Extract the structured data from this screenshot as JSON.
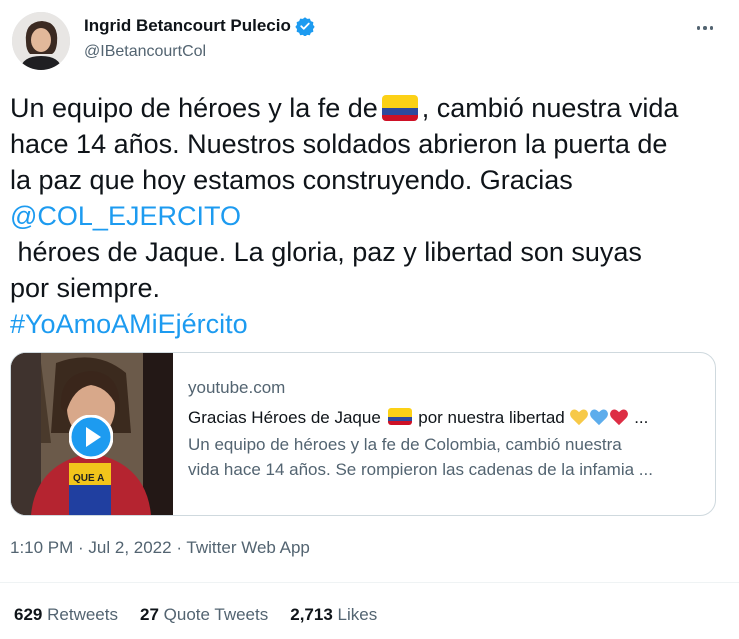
{
  "author": {
    "display_name": "Ingrid Betancourt Pulecio",
    "handle": "@IBetancourtCol"
  },
  "tweet": {
    "line1_a": "Un equipo de héroes y la fe de",
    "line1_b": ", cambió nuestra vida",
    "line2": "hace 14 años. Nuestros soldados abrieron la puerta de",
    "line3": "la paz que hoy estamos construyendo. Gracias",
    "mention": "@COL_EJERCITO",
    "line5": " héroes de Jaque. La gloria, paz y libertad son suyas",
    "line6": "por siempre.",
    "hashtag": "#YoAmoAMiEjército"
  },
  "card": {
    "domain": "youtube.com",
    "title_a": "Gracias Héroes de Jaque",
    "title_b": "por nuestra libertad",
    "title_ellipsis": "...",
    "desc_line1": "Un equipo de héroes y la fe de Colombia, cambió nuestra",
    "desc_line2": "vida hace 14 años. Se rompieron las cadenas de la infamia ..."
  },
  "meta": {
    "time": "1:10 PM",
    "sep": " · ",
    "date": "Jul 2, 2022",
    "app": "Twitter Web App"
  },
  "stats": {
    "retweets_count": "629",
    "retweets_label": "Retweets",
    "quotes_count": "27",
    "quotes_label": "Quote Tweets",
    "likes_count": "2,713",
    "likes_label": "Likes"
  },
  "icons": {
    "verified": "verified-badge-icon",
    "more": "more-options-icon",
    "play": "play-icon",
    "flag": "colombia-flag-emoji",
    "hearts": [
      "yellow-heart-icon",
      "blue-heart-icon",
      "red-heart-icon"
    ]
  },
  "colors": {
    "accent": "#1d9bf0",
    "text": "#0f1419",
    "secondary": "#536471",
    "border": "#cfd9de"
  }
}
